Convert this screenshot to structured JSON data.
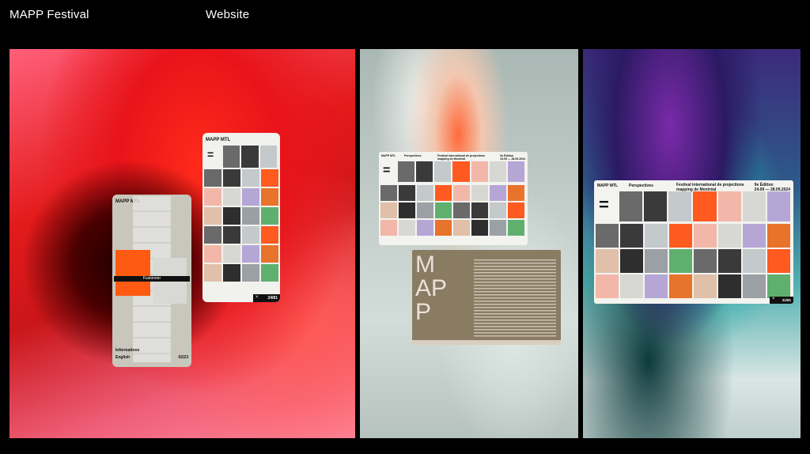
{
  "header": {
    "project_title": "MAPP Festival",
    "category": "Website"
  },
  "mobile_menu": {
    "brand": "MAPP MTL",
    "button_label": "Fusionner",
    "links": [
      "Informations",
      "English"
    ],
    "pager": "02/23"
  },
  "mobile_grid": {
    "brand": "MAPP MTL",
    "pager": "24/81",
    "close": "×"
  },
  "desktop_small": {
    "brand": "MAPP MTL",
    "nav": "Perspectives",
    "tagline_line1": "Festival international de projections",
    "tagline_line2": "mapping de Montréal",
    "edition": "9e Édition",
    "dates": "24.09 — 28.09.2024"
  },
  "about_card": {
    "letters": [
      "M",
      "A",
      "P",
      "P"
    ]
  },
  "desktop_large": {
    "brand": "MAPP MTL",
    "nav": "Perspectives",
    "tagline_line1": "Festival international de projections",
    "tagline_line2": "mapping de Montréal",
    "edition": "9e Édition",
    "dates": "24.09 — 28.09.2024",
    "pager": "31/81",
    "close": "×"
  },
  "colors": {
    "tile_palette": [
      "#ff5a1f",
      "#9aa0a4",
      "#d7d7d4",
      "#6a6a6a",
      "#e8732a",
      "#c4c9cb",
      "#2e2e2e",
      "#f2b7a8",
      "#5fb06f",
      "#b6a6d6",
      "#3a3a3a",
      "#e0c0a8"
    ]
  }
}
